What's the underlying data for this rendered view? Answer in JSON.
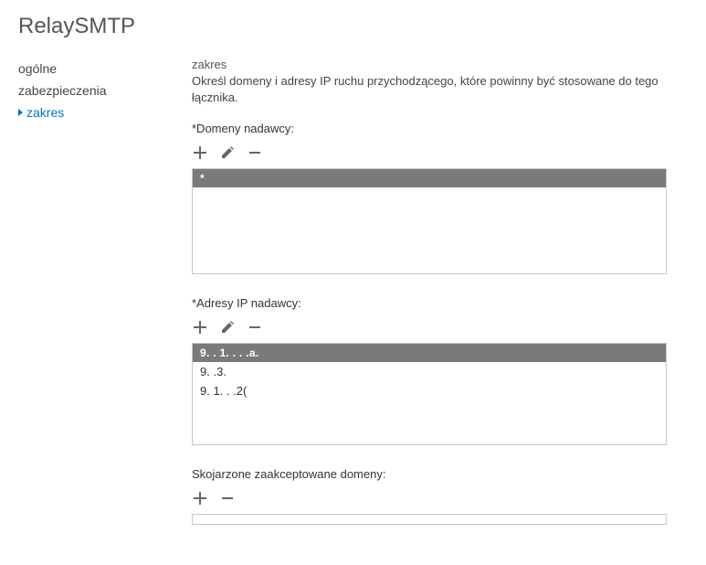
{
  "title": "RelaySMTP",
  "sidebar": {
    "items": [
      {
        "label": "ogólne"
      },
      {
        "label": "zabezpieczenia"
      },
      {
        "label": "zakres"
      }
    ],
    "activeIndex": 2
  },
  "section": {
    "heading": "zakres",
    "description": "Określ domeny i adresy IP ruchu przychodzącego, które powinny być stosowane do tego łącznika."
  },
  "senderDomains": {
    "label": "*Domeny nadawcy:",
    "rows": [
      "*"
    ],
    "selectedIndex": 0
  },
  "senderIPs": {
    "label": "*Adresy IP nadawcy:",
    "rows": [
      "9. .  1. . . .a.",
      "9.       .3.",
      "9.    1. . .2("
    ],
    "selectedIndex": 0
  },
  "assocDomains": {
    "label": "Skojarzone zaakceptowane domeny:"
  }
}
